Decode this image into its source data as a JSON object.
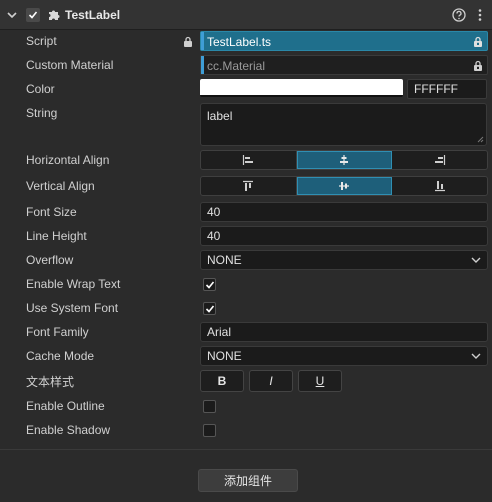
{
  "component": {
    "title": "TestLabel",
    "enabled": true
  },
  "labels": {
    "script": "Script",
    "custom_material": "Custom Material",
    "color": "Color",
    "string": "String",
    "horizontal_align": "Horizontal Align",
    "vertical_align": "Vertical Align",
    "font_size": "Font Size",
    "line_height": "Line Height",
    "overflow": "Overflow",
    "enable_wrap_text": "Enable Wrap Text",
    "use_system_font": "Use System Font",
    "font_family": "Font Family",
    "cache_mode": "Cache Mode",
    "text_style": "文本样式",
    "enable_outline": "Enable Outline",
    "enable_shadow": "Enable Shadow"
  },
  "values": {
    "script": "TestLabel.ts",
    "custom_material": "cc.Material",
    "color_hex": "FFFFFF",
    "color": "#ffffff",
    "string": "label",
    "horizontal_align_selected": "center",
    "vertical_align_selected": "center",
    "font_size": "40",
    "line_height": "40",
    "overflow": "NONE",
    "enable_wrap_text": true,
    "use_system_font": true,
    "font_family": "Arial",
    "cache_mode": "NONE",
    "enable_outline": false,
    "enable_shadow": false
  },
  "text_style_buttons": {
    "bold": "B",
    "italic": "I",
    "underline": "U"
  },
  "add_component_label": "添加组件",
  "colors": {
    "accent": "#1e5f7a",
    "selected_asset": "#1f6f8c",
    "background": "#2b2b2b"
  }
}
